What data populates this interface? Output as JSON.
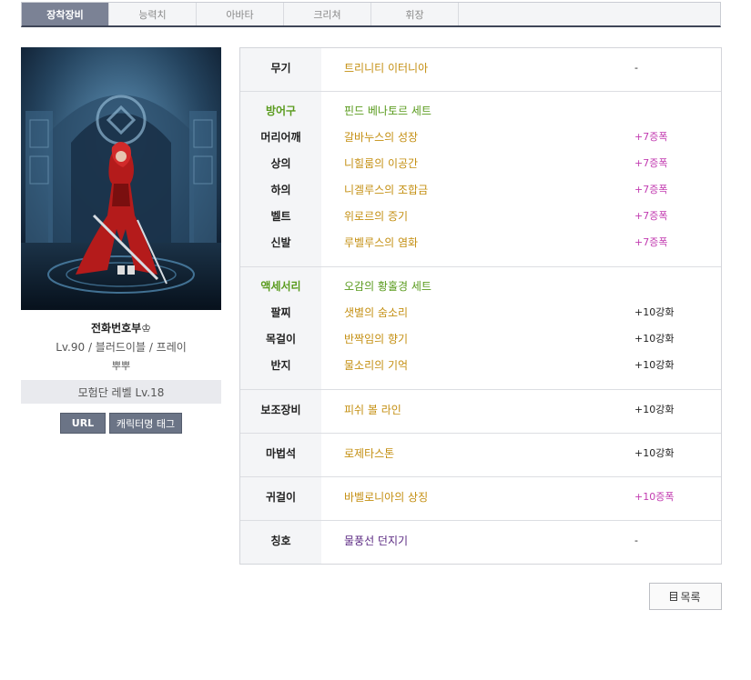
{
  "tabs": [
    "장착장비",
    "능력치",
    "아바타",
    "크리쳐",
    "휘장"
  ],
  "character": {
    "name": "전화번호부♔",
    "info": "Lv.90 / 블러드이블 / 프레이",
    "guild": "뿌뿌",
    "adventure_level": "모험단 레벨 Lv.18",
    "url_button": "URL",
    "tag_button": "캐릭터명 태그"
  },
  "equipment": {
    "weapon": {
      "label": "무기",
      "name": "트리니티 이터니아",
      "upgrade": "-"
    },
    "armor": {
      "label": "방어구",
      "set": "핀드 베나토르 세트",
      "items": [
        {
          "slot": "머리어깨",
          "name": "갈바누스의 성장",
          "upgrade": "+7증폭"
        },
        {
          "slot": "상의",
          "name": "니힐룸의 이공간",
          "upgrade": "+7증폭"
        },
        {
          "slot": "하의",
          "name": "니겔루스의 조합금",
          "upgrade": "+7증폭"
        },
        {
          "slot": "벨트",
          "name": "위로르의 증기",
          "upgrade": "+7증폭"
        },
        {
          "slot": "신발",
          "name": "루벨루스의 염화",
          "upgrade": "+7증폭"
        }
      ]
    },
    "accessory": {
      "label": "액세서리",
      "set": "오감의 황홀경 세트",
      "items": [
        {
          "slot": "팔찌",
          "name": "샛별의 숨소리",
          "upgrade": "+10강화"
        },
        {
          "slot": "목걸이",
          "name": "반짝임의 향기",
          "upgrade": "+10강화"
        },
        {
          "slot": "반지",
          "name": "물소리의 기억",
          "upgrade": "+10강화"
        }
      ]
    },
    "sub": {
      "label": "보조장비",
      "name": "피쉬 볼 라인",
      "upgrade": "+10강화"
    },
    "magic": {
      "label": "마법석",
      "name": "로제타스톤",
      "upgrade": "+10강화"
    },
    "earring": {
      "label": "귀걸이",
      "name": "바벨로니아의 상징",
      "upgrade": "+10증폭"
    },
    "title": {
      "label": "칭호",
      "name": "물풍선 던지기",
      "upgrade": "-"
    }
  },
  "list_button": "목록",
  "colors": {
    "tab_active": "#7b8295",
    "item_gold": "#c48f12",
    "set_green": "#5a9b1e",
    "amplify_magenta": "#c23bb0",
    "title_purple": "#5c2b83"
  }
}
